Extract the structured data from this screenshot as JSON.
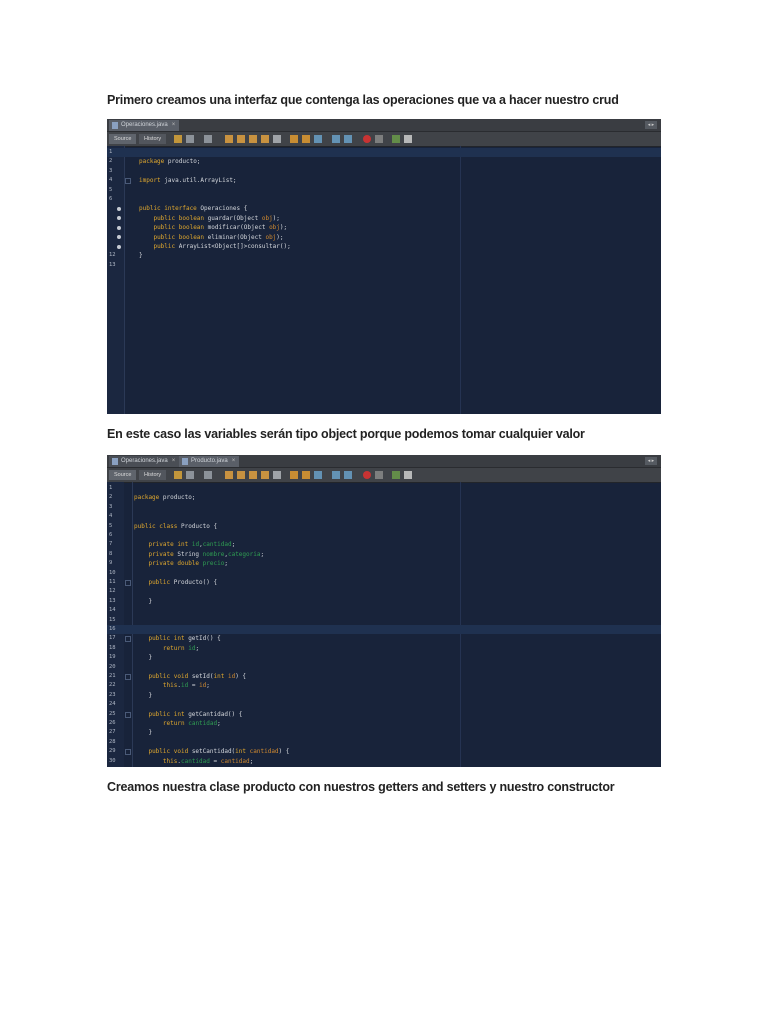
{
  "captions": [
    "Primero creamos una interfaz que contenga las operaciones que va a hacer nuestro crud",
    "En este caso las variables serán tipo object porque podemos tomar cualquier valor",
    "Creamos nuestra clase producto con nuestros getters and setters y nuestro constructor"
  ],
  "toolbar": {
    "source": "Source",
    "history": "History"
  },
  "editor1": {
    "tabs": [
      "Operaciones.java"
    ],
    "lines": [
      [],
      [
        [
          "k",
          "package"
        ],
        [
          "t",
          " producto;"
        ]
      ],
      [],
      [
        [
          "k",
          "import"
        ],
        [
          "t",
          " java.util.ArrayList;"
        ]
      ],
      [],
      [],
      [
        [
          "k",
          "public interface"
        ],
        [
          "t",
          " Operaciones {"
        ]
      ],
      [
        [
          "t",
          "    "
        ],
        [
          "k",
          "public boolean"
        ],
        [
          "t",
          " guardar(Object "
        ],
        [
          "p",
          "obj"
        ],
        [
          "t",
          ");"
        ]
      ],
      [
        [
          "t",
          "    "
        ],
        [
          "k",
          "public boolean"
        ],
        [
          "t",
          " modificar(Object "
        ],
        [
          "p",
          "obj"
        ],
        [
          "t",
          ");"
        ]
      ],
      [
        [
          "t",
          "    "
        ],
        [
          "k",
          "public boolean"
        ],
        [
          "t",
          " eliminar(Object "
        ],
        [
          "p",
          "obj"
        ],
        [
          "t",
          ");"
        ]
      ],
      [
        [
          "t",
          "    "
        ],
        [
          "k",
          "public"
        ],
        [
          "t",
          " ArrayList<Object[]>consultar();"
        ]
      ],
      [
        [
          "t",
          "}"
        ]
      ],
      []
    ]
  },
  "editor2": {
    "tabs": [
      "Operaciones.java",
      "Producto.java"
    ],
    "lines": [
      [],
      [
        [
          "k",
          "package"
        ],
        [
          "t",
          " producto;"
        ]
      ],
      [],
      [],
      [
        [
          "k",
          "public class"
        ],
        [
          "t",
          " Producto {"
        ]
      ],
      [],
      [
        [
          "t",
          "    "
        ],
        [
          "k",
          "private int"
        ],
        [
          "t",
          " "
        ],
        [
          "f",
          "id"
        ],
        [
          "t",
          ","
        ],
        [
          "f",
          "cantidad"
        ],
        [
          "t",
          ";"
        ]
      ],
      [
        [
          "t",
          "    "
        ],
        [
          "k",
          "private"
        ],
        [
          "t",
          " String "
        ],
        [
          "f",
          "nombre"
        ],
        [
          "t",
          ","
        ],
        [
          "f",
          "categoria"
        ],
        [
          "t",
          ";"
        ]
      ],
      [
        [
          "t",
          "    "
        ],
        [
          "k",
          "private double"
        ],
        [
          "t",
          " "
        ],
        [
          "f",
          "precio"
        ],
        [
          "t",
          ";"
        ]
      ],
      [],
      [
        [
          "t",
          "    "
        ],
        [
          "k",
          "public"
        ],
        [
          "t",
          " Producto() {"
        ]
      ],
      [],
      [
        [
          "t",
          "    }"
        ]
      ],
      [],
      [],
      [],
      [
        [
          "t",
          "    "
        ],
        [
          "k",
          "public int"
        ],
        [
          "t",
          " getId() {"
        ]
      ],
      [
        [
          "t",
          "        "
        ],
        [
          "k",
          "return"
        ],
        [
          "t",
          " "
        ],
        [
          "f",
          "id"
        ],
        [
          "t",
          ";"
        ]
      ],
      [
        [
          "t",
          "    }"
        ]
      ],
      [],
      [
        [
          "t",
          "    "
        ],
        [
          "k",
          "public void"
        ],
        [
          "t",
          " setId("
        ],
        [
          "k",
          "int"
        ],
        [
          "t",
          " "
        ],
        [
          "p",
          "id"
        ],
        [
          "t",
          ") {"
        ]
      ],
      [
        [
          "t",
          "        "
        ],
        [
          "k",
          "this"
        ],
        [
          "t",
          "."
        ],
        [
          "f",
          "id"
        ],
        [
          "t",
          " = "
        ],
        [
          "p",
          "id"
        ],
        [
          "t",
          ";"
        ]
      ],
      [
        [
          "t",
          "    }"
        ]
      ],
      [],
      [
        [
          "t",
          "    "
        ],
        [
          "k",
          "public int"
        ],
        [
          "t",
          " getCantidad() {"
        ]
      ],
      [
        [
          "t",
          "        "
        ],
        [
          "k",
          "return"
        ],
        [
          "t",
          " "
        ],
        [
          "f",
          "cantidad"
        ],
        [
          "t",
          ";"
        ]
      ],
      [
        [
          "t",
          "    }"
        ]
      ],
      [],
      [
        [
          "t",
          "    "
        ],
        [
          "k",
          "public void"
        ],
        [
          "t",
          " setCantidad("
        ],
        [
          "k",
          "int"
        ],
        [
          "t",
          " "
        ],
        [
          "p",
          "cantidad"
        ],
        [
          "t",
          ") {"
        ]
      ],
      [
        [
          "t",
          "        "
        ],
        [
          "k",
          "this"
        ],
        [
          "t",
          "."
        ],
        [
          "f",
          "cantidad"
        ],
        [
          "t",
          " = "
        ],
        [
          "p",
          "cantidad"
        ],
        [
          "t",
          ";"
        ]
      ]
    ]
  }
}
